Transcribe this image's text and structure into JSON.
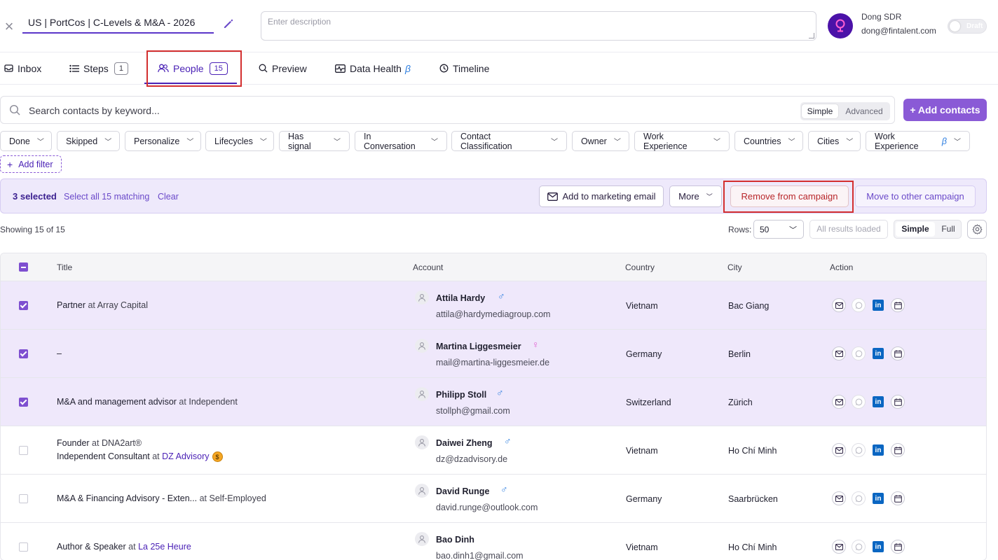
{
  "header": {
    "campaign_title": "US | PortCos | C-Levels & M&A - 2026",
    "description_placeholder": "Enter description",
    "user_name": "Dong SDR",
    "user_email": "dong@fintalent.com",
    "status_toggle_label": "Draft"
  },
  "tabs": [
    {
      "label": "Inbox"
    },
    {
      "label": "Steps",
      "count": "1"
    },
    {
      "label": "People",
      "count": "15",
      "active": true
    },
    {
      "label": "Preview"
    },
    {
      "label": "Data Health",
      "suffix": "β"
    },
    {
      "label": "Timeline"
    }
  ],
  "search": {
    "placeholder": "Search contacts by keyword...",
    "mode_simple": "Simple",
    "mode_advanced": "Advanced",
    "add_contacts_label": "+ Add contacts"
  },
  "filters": [
    "Done",
    "Skipped",
    "Personalize",
    "Lifecycles",
    "Has signal",
    "In Conversation",
    "Contact Classification",
    "Owner",
    "Work Experience",
    "Countries",
    "Cities",
    "Work Experience"
  ],
  "filters_beta_suffix": "β",
  "add_filter_label": "Add filter",
  "selection": {
    "count_label": "3 selected",
    "select_all_label": "Select all 15 matching",
    "clear_label": "Clear",
    "add_to_email_label": "Add to marketing email",
    "more_label": "More",
    "remove_label": "Remove from campaign",
    "move_label": "Move to other campaign"
  },
  "list_controls": {
    "showing": "Showing 15 of 15",
    "rows_label": "Rows:",
    "rows_value": "50",
    "all_loaded": "All results loaded",
    "view_simple": "Simple",
    "view_full": "Full"
  },
  "table": {
    "columns": [
      "Title",
      "Account",
      "Country",
      "City",
      "Action"
    ],
    "rows": [
      {
        "selected": true,
        "title_role": "Partner",
        "title_at": "at",
        "title_company": "Array Capital",
        "name": "Attila Hardy",
        "gender": "male",
        "email": "attila@hardymediagroup.com",
        "country": "Vietnam",
        "city": "Bac Giang"
      },
      {
        "selected": true,
        "title_role": "–",
        "title_at": "",
        "title_company": "",
        "name": "Martina Liggesmeier",
        "gender": "female",
        "email": "mail@martina-liggesmeier.de",
        "country": "Germany",
        "city": "Berlin"
      },
      {
        "selected": true,
        "title_role": "M&A and management advisor",
        "title_at": "at",
        "title_company": "Independent",
        "name": "Philipp Stoll",
        "gender": "male",
        "email": "stollph@gmail.com",
        "country": "Switzerland",
        "city": "Zürich"
      },
      {
        "selected": false,
        "title_role": "Founder",
        "title_at": "at",
        "title_company": "DNA2art®",
        "title_role2": "Independent Consultant",
        "title_at2": "at",
        "title_company2": "DZ Advisory",
        "title_badge2": "$",
        "name": "Daiwei Zheng",
        "gender": "male",
        "email": "dz@dzadvisory.de",
        "country": "Vietnam",
        "city": "Ho Chí Minh"
      },
      {
        "selected": false,
        "title_role": "M&A & Financing Advisory - Exten...",
        "title_at": "at",
        "title_company": "Self-Employed",
        "name": "David Runge",
        "gender": "male",
        "email": "david.runge@outlook.com",
        "country": "Germany",
        "city": "Saarbrücken"
      },
      {
        "selected": false,
        "title_role": "Author & Speaker",
        "title_at": "at",
        "title_company": "La 25e Heure",
        "name": "Bao Dinh",
        "gender": "",
        "email": "bao.dinh1@gmail.com",
        "country": "Vietnam",
        "city": "Ho Chí Minh"
      }
    ]
  },
  "colors": {
    "accent": "#4b22b6",
    "accent_button": "#8a5ad6",
    "selected_row_bg": "#efe8fb",
    "remove_text": "#b8262a",
    "male_icon": "#2f7fe0",
    "female_icon": "#e05ad0",
    "linkedin": "#0a66c2"
  },
  "icons": {
    "close": "close-icon",
    "edit": "pencil-icon",
    "inbox": "inbox-icon",
    "steps": "list-icon",
    "people": "people-icon",
    "preview": "search-icon",
    "data_health": "pulse-icon",
    "timeline": "history-icon",
    "settings": "gear-icon",
    "row_actions": [
      "mail-icon",
      "whatsapp-icon",
      "linkedin-icon",
      "calendar-icon"
    ]
  }
}
